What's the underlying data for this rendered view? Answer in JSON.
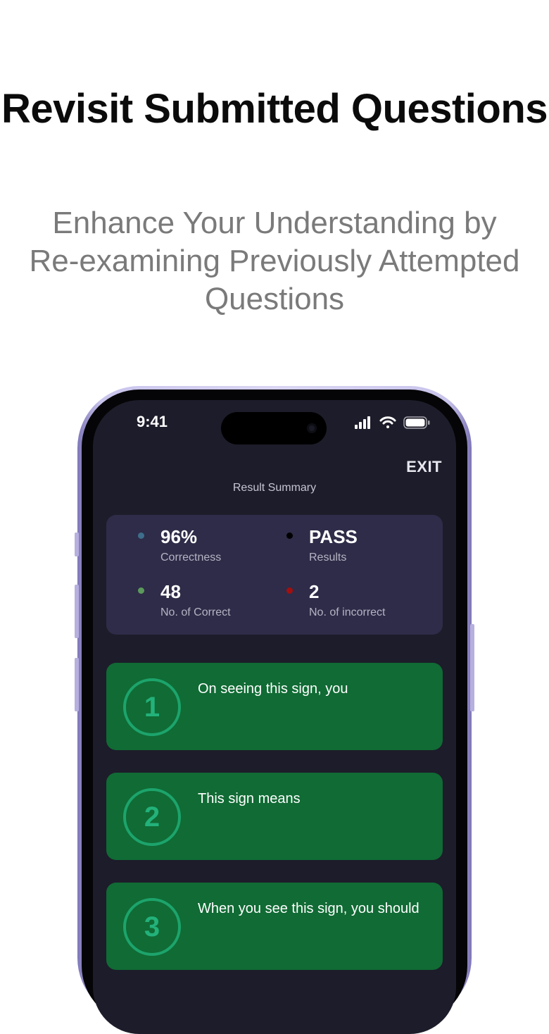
{
  "headline": "Revisit Submitted Questions",
  "subheadline": "Enhance Your Understanding by Re-examining Previously Attempted Questions",
  "phone": {
    "status_time": "9:41",
    "exit_label": "EXIT",
    "summary_title": "Result Summary",
    "stats": [
      {
        "value": "96%",
        "label": "Correctness",
        "dot_color": "#3f6d8c"
      },
      {
        "value": "PASS",
        "label": "Results",
        "dot_color": "#000000"
      },
      {
        "value": "48",
        "label": "No. of Correct",
        "dot_color": "#5b9a5b"
      },
      {
        "value": "2",
        "label": "No. of incorrect",
        "dot_color": "#a30f0f"
      }
    ],
    "questions": [
      {
        "number": "1",
        "text": "On seeing this sign, you"
      },
      {
        "number": "2",
        "text": "This sign means"
      },
      {
        "number": "3",
        "text": "When you see this sign, you should"
      }
    ]
  },
  "colors": {
    "background": "#ffffff",
    "screen": "#1d1c2a",
    "summary_card": "#2e2c48",
    "question_card": "#106b34",
    "question_circle": "#1ca46c"
  }
}
